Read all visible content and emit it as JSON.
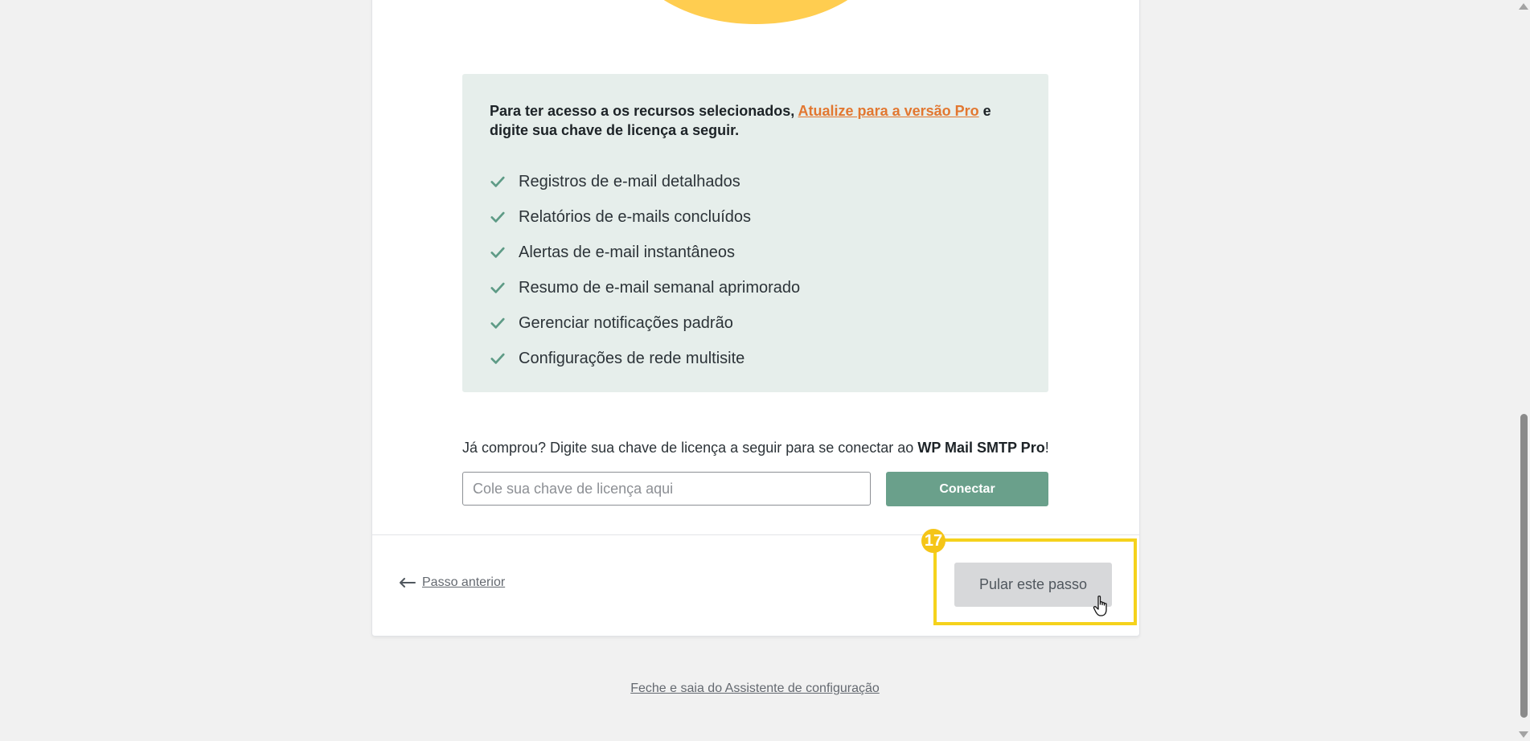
{
  "info_box": {
    "intro_before": "Para ter acesso a os recursos selecionados, ",
    "intro_link": "Atualize para a versão Pro",
    "intro_after": " e digite sua chave de licença a seguir.",
    "features": [
      "Registros de e-mail detalhados",
      "Relatórios de e-mails concluídos",
      "Alertas de e-mail instantâneos",
      "Resumo de e-mail semanal aprimorado",
      "Gerenciar notificações padrão",
      "Configurações de rede multisite"
    ]
  },
  "license": {
    "prompt_before": "Já comprou? Digite sua chave de licença a seguir para se conectar ao ",
    "prompt_product": "WP Mail SMTP Pro",
    "prompt_after": "!",
    "placeholder": "Cole sua chave de licença aqui",
    "value": "",
    "connect_label": "Conectar"
  },
  "footer": {
    "prev_label": "Passo anterior",
    "skip_label": "Pular este passo",
    "step_badge": "17",
    "exit_label": "Feche e saia do Assistente de configuração"
  },
  "colors": {
    "accent_green": "#6aa08b",
    "link_orange": "#e27730",
    "highlight_yellow": "#f5d21c",
    "info_bg": "#e6eeeb"
  },
  "icons": {
    "check": "check-icon",
    "arrow": "arrow-left-icon",
    "cursor": "hand-cursor-icon"
  }
}
